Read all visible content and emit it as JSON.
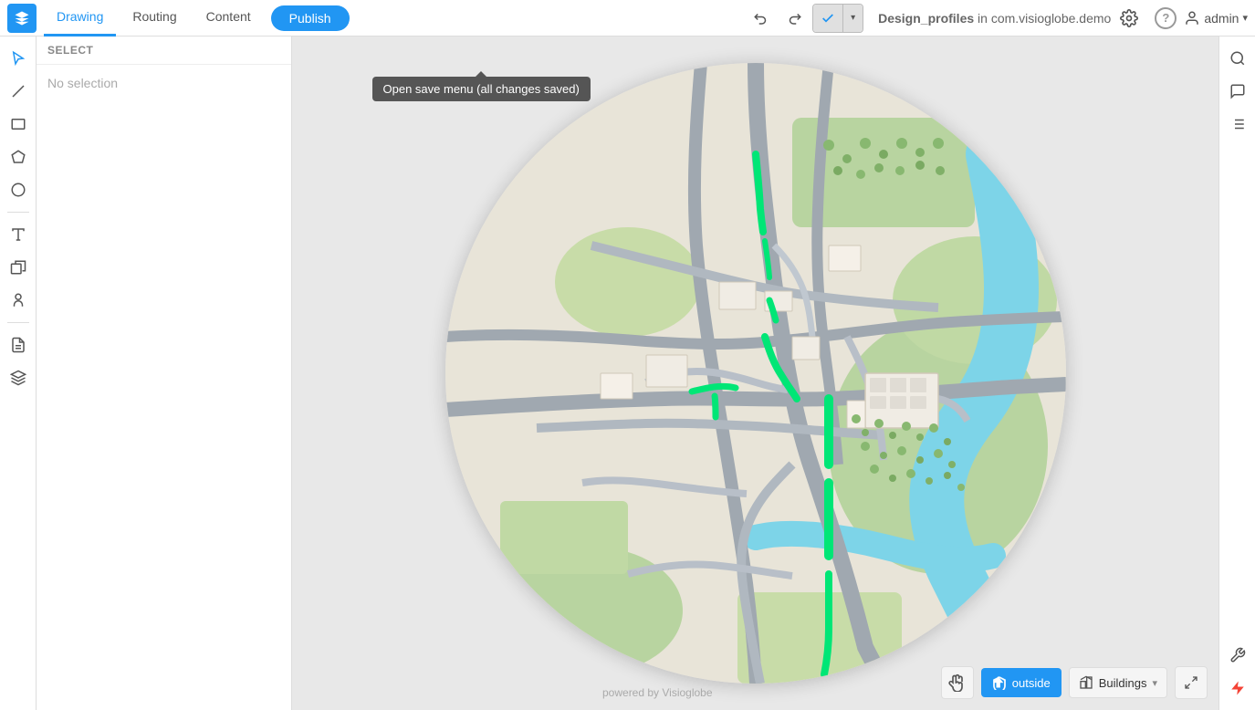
{
  "topbar": {
    "logo_label": "V",
    "tabs": [
      {
        "id": "drawing",
        "label": "Drawing",
        "active": true
      },
      {
        "id": "routing",
        "label": "Routing",
        "active": false
      },
      {
        "id": "content",
        "label": "Content",
        "active": false
      }
    ],
    "publish_label": "Publish",
    "undo_icon": "↩",
    "redo_icon": "↪",
    "save_icon": "✓",
    "save_dropdown_icon": "▾",
    "project_name": "Design_profiles",
    "project_context": " in com.visioglobe.demo",
    "settings_icon": "⚙",
    "help_icon": "?",
    "user_label": "admin",
    "user_dropdown": "▾"
  },
  "tooltip": {
    "text": "Open save menu (all changes saved)"
  },
  "left_toolbar": {
    "tools": [
      {
        "id": "pointer",
        "icon": "↖",
        "label": "pointer-tool"
      },
      {
        "id": "line",
        "icon": "↗",
        "label": "line-tool"
      },
      {
        "id": "rectangle",
        "icon": "▭",
        "label": "rectangle-tool"
      },
      {
        "id": "polygon",
        "icon": "⬡",
        "label": "polygon-tool"
      },
      {
        "id": "circle",
        "icon": "○",
        "label": "circle-tool"
      },
      {
        "id": "text",
        "icon": "T",
        "label": "text-tool"
      },
      {
        "id": "3d",
        "icon": "◫",
        "label": "3d-tool"
      },
      {
        "id": "person",
        "icon": "☻",
        "label": "person-tool"
      },
      {
        "id": "layer-page",
        "icon": "⊡",
        "label": "layer-page-tool"
      },
      {
        "id": "layers",
        "icon": "◈",
        "label": "layers-tool"
      }
    ]
  },
  "side_panel": {
    "header": "SELECT",
    "no_selection": "No selection"
  },
  "map": {
    "footer": "powered by Visioglobe"
  },
  "map_controls": {
    "outside_icon": "⌂",
    "outside_label": "outside",
    "buildings_label": "Buildings",
    "buildings_dropdown": "▾"
  },
  "right_sidebar": {
    "search_icon": "🔍",
    "chat_icon": "💬",
    "list_icon": "≡",
    "wrench_icon": "🔧",
    "lightning_icon": "⚡"
  }
}
